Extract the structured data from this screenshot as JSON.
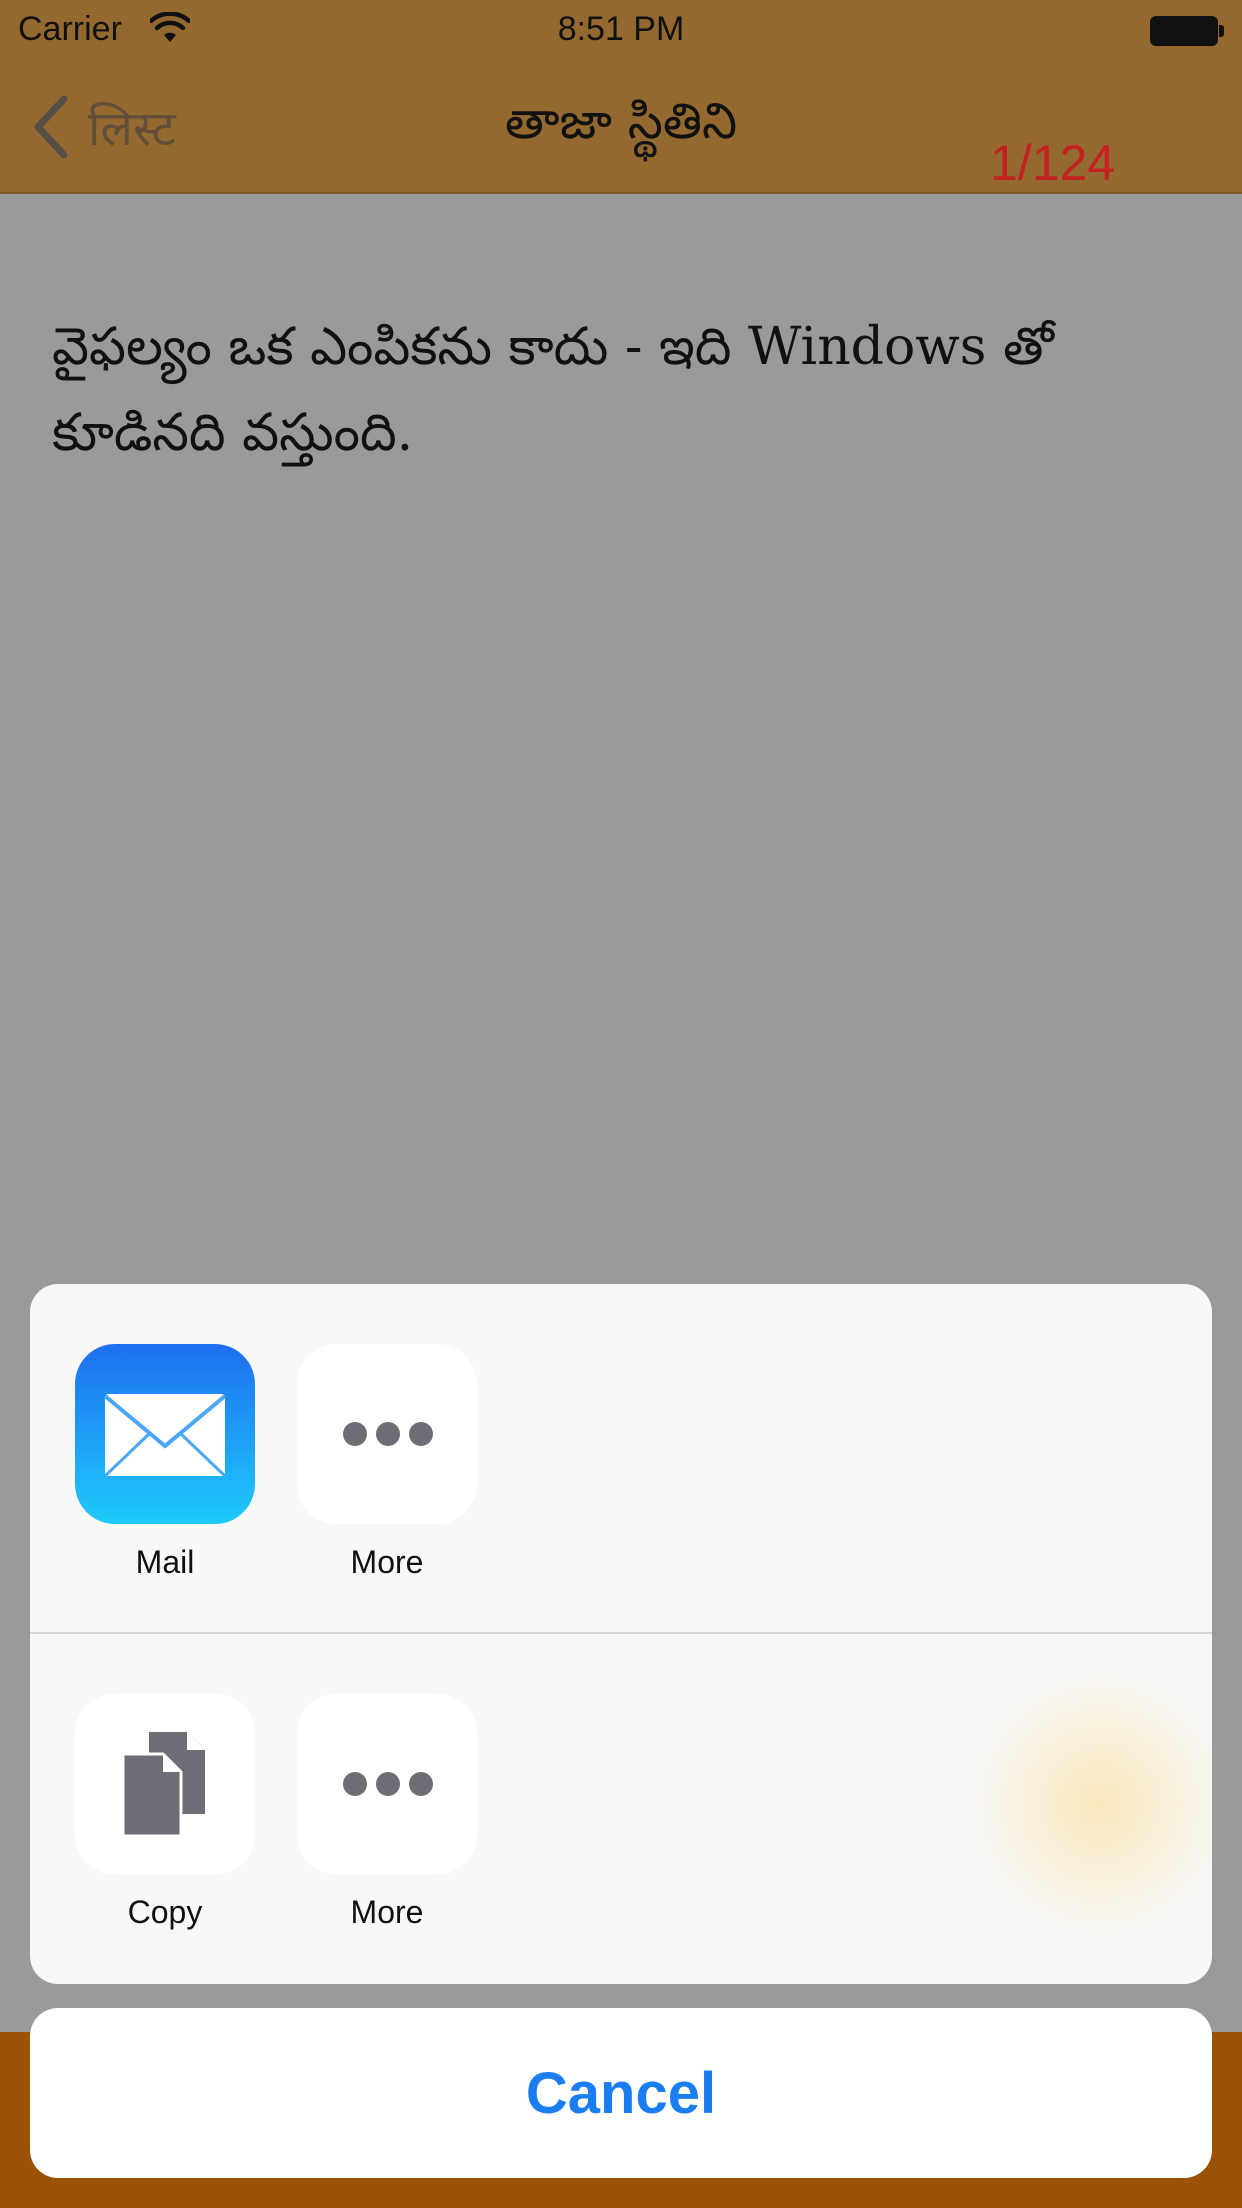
{
  "status_bar": {
    "carrier": "Carrier",
    "time": "8:51 PM"
  },
  "nav": {
    "back_label": "लिस्ट",
    "title": "తాజా స్థితిని",
    "counter": "1/124"
  },
  "quote": {
    "text": "వైఫల్యం ఒక ఎంపికను కాదు - ఇది Windows తో కూడినది వస్తుంది."
  },
  "share_sheet": {
    "apps": [
      {
        "label": "Mail",
        "icon": "mail-icon"
      },
      {
        "label": "More",
        "icon": "more-icon"
      }
    ],
    "actions": [
      {
        "label": "Copy",
        "icon": "copy-icon"
      },
      {
        "label": "More",
        "icon": "more-icon"
      }
    ],
    "cancel_label": "Cancel"
  },
  "colors": {
    "nav_bar": "#946930",
    "toolbar": "#9a5206",
    "counter": "#c42020",
    "cancel": "#1a7ef2"
  }
}
